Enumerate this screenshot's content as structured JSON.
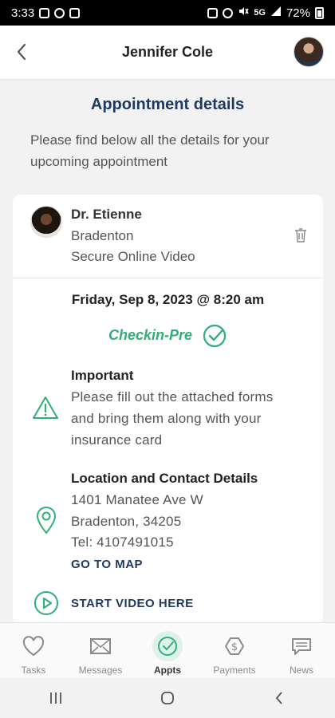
{
  "status_bar": {
    "time": "3:33",
    "network": "5G",
    "battery": "72%"
  },
  "header": {
    "title": "Jennifer Cole"
  },
  "page": {
    "title": "Appointment details",
    "description": "Please find below all the details for your upcoming appointment"
  },
  "appointment": {
    "doctor_name": "Dr. Etienne",
    "city": "Bradenton",
    "visit_type": "Secure Online Video",
    "datetime": "Friday, Sep 8, 2023 @ 8:20 am",
    "status": "Checkin-Pre",
    "important": {
      "title": "Important",
      "lines": [
        "Please fill out the attached forms",
        "and bring them along with your",
        "insurance card"
      ]
    },
    "location": {
      "title": "Location and Contact Details",
      "address_line1": "1401 Manatee Ave W",
      "address_line2": "Bradenton, 34205",
      "phone": "Tel: 4107491015",
      "map_link": "GO TO MAP"
    },
    "video_link": "START VIDEO HERE"
  },
  "bottom_nav": {
    "items": [
      {
        "label": "Tasks",
        "icon": "heart-icon"
      },
      {
        "label": "Messages",
        "icon": "envelope-icon"
      },
      {
        "label": "Appts",
        "icon": "clock-check-icon"
      },
      {
        "label": "Payments",
        "icon": "dollar-icon"
      },
      {
        "label": "News",
        "icon": "newspaper-icon"
      }
    ],
    "active": "Appts"
  },
  "colors": {
    "accent": "#2fae7a",
    "heading": "#1f3a60",
    "active_bg": "#dff2ea"
  }
}
